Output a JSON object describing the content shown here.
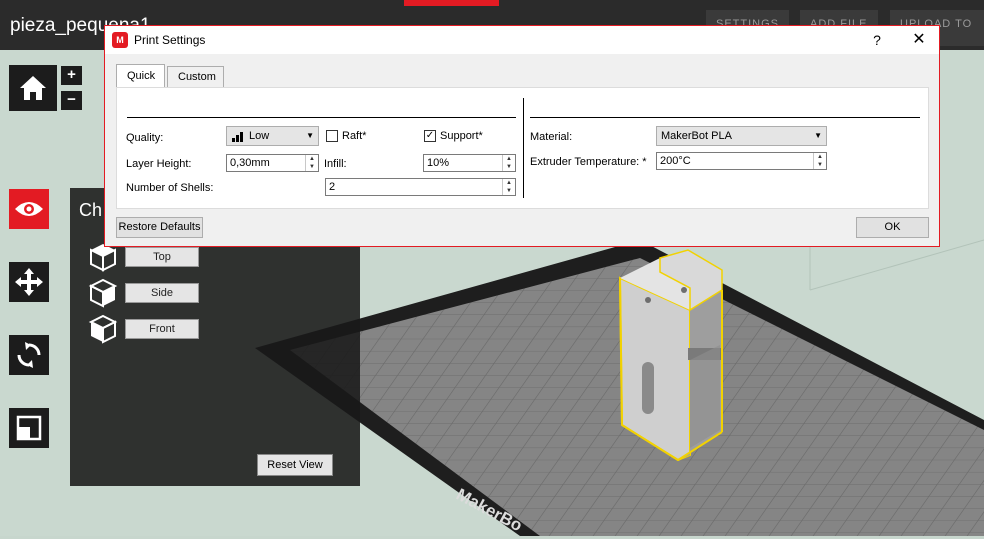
{
  "app": {
    "file_title": "pieza_pequena1",
    "tabs": [
      {
        "label": "SETTINGS"
      },
      {
        "label": "ADD FILE"
      },
      {
        "label": "UPLOAD TO LI"
      }
    ]
  },
  "toolbar": {
    "zoom_in": "+",
    "zoom_out": "−"
  },
  "view_panel": {
    "title": "Ch",
    "buttons": [
      "Top",
      "Side",
      "Front"
    ],
    "reset_label": "Reset View"
  },
  "platform": {
    "logo_text": "MakerBo"
  },
  "dialog": {
    "title": "Print Settings",
    "help": "?",
    "close": "✕",
    "tabs": [
      "Quick",
      "Custom"
    ],
    "quality_label": "Quality:",
    "quality_value": "Low",
    "raft_label": "Raft*",
    "raft_checked": false,
    "support_label": "Support*",
    "support_checked": true,
    "layer_height_label": "Layer Height:",
    "layer_height_value": "0,30mm",
    "infill_label": "Infill:",
    "infill_value": "10%",
    "shells_label": "Number of Shells:",
    "shells_value": "2",
    "material_label": "Material:",
    "material_value": "MakerBot PLA",
    "temp_label": "Extruder Temperature: *",
    "temp_value": "200°C",
    "restore_label": "Restore Defaults",
    "ok_label": "OK"
  },
  "colors": {
    "accent": "#e31b23",
    "toolbar_bg": "#1c1c1c",
    "build_plate": "#7c7c7c",
    "model": "#c8c8c8",
    "model_outline": "#f2d200"
  }
}
